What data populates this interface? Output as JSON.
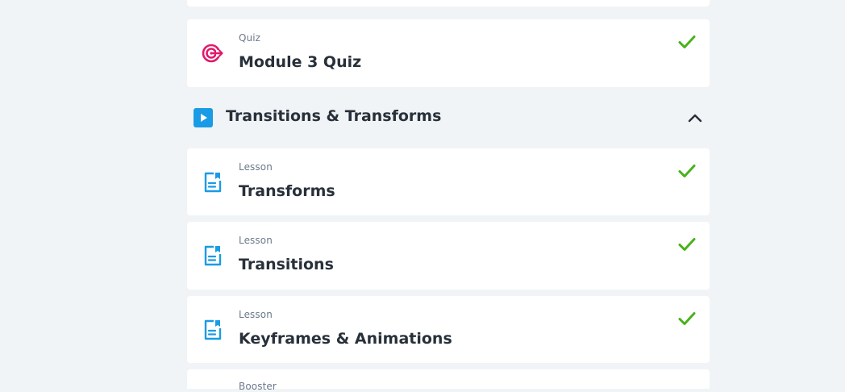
{
  "colors": {
    "quiz_icon": "#e0196b",
    "lesson_icon": "#1a9be6",
    "play_icon_bg": "#1a9be6",
    "check": "#49b21c",
    "title_text": "#28303a",
    "type_text": "#6b7a8c",
    "page_bg": "#f1f4f7"
  },
  "items": [
    {
      "type": "Quiz",
      "title": "Module 3 Quiz",
      "icon": "target-icon",
      "completed": true
    }
  ],
  "section": {
    "title": "Transitions & Transforms",
    "icon": "play-icon",
    "expanded": true,
    "toggle_icon": "chevron-up-icon",
    "items": [
      {
        "type": "Lesson",
        "title": "Transforms",
        "icon": "lesson-document-icon",
        "completed": true
      },
      {
        "type": "Lesson",
        "title": "Transitions",
        "icon": "lesson-document-icon",
        "completed": true
      },
      {
        "type": "Lesson",
        "title": "Keyframes & Animations",
        "icon": "lesson-document-icon",
        "completed": true
      },
      {
        "type": "Booster",
        "title": "",
        "icon": "",
        "completed": false
      }
    ]
  }
}
